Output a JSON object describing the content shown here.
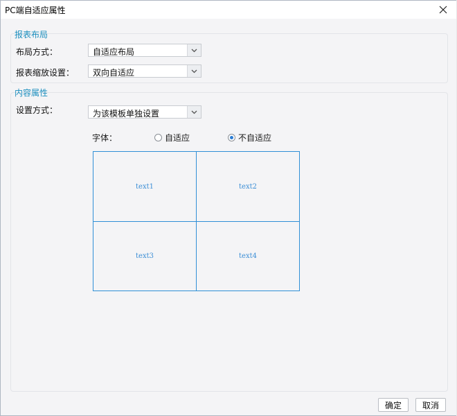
{
  "window": {
    "title": "PC端自适应属性"
  },
  "report_layout": {
    "title": "报表布局",
    "layout_mode": {
      "label": "布局方式：",
      "value": "自适应布局"
    },
    "zoom_setting": {
      "label": "报表缩放设置：",
      "value": "双向自适应"
    }
  },
  "content": {
    "title": "内容属性",
    "setting_mode": {
      "label": "设置方式：",
      "value": "为该模板单独设置"
    },
    "font": {
      "label": "字体：",
      "options": [
        {
          "label": "自适应",
          "checked": false
        },
        {
          "label": "不自适应",
          "checked": true
        }
      ]
    },
    "preview": {
      "cells": [
        "text1",
        "text2",
        "text3",
        "text4"
      ]
    }
  },
  "buttons": {
    "ok": "确定",
    "cancel": "取消"
  },
  "colors": {
    "accent": "#1c8fbf",
    "grid": "#2f8fd6",
    "radio_checked": "#2b7cd3"
  }
}
